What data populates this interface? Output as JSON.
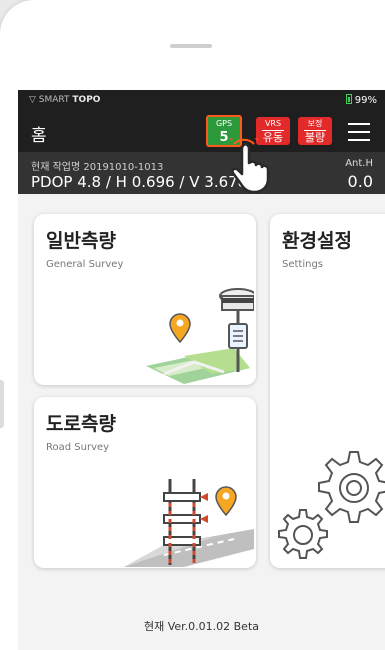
{
  "status_bar": {
    "brand_prefix": "SMART",
    "brand_name": "TOPO",
    "battery": "99%"
  },
  "app_bar": {
    "title": "홈",
    "gps": {
      "label": "GPS",
      "value": "5"
    },
    "vrs": {
      "label": "VRS",
      "value": "유동"
    },
    "correction": {
      "label": "보정",
      "value": "불량"
    }
  },
  "info_bar": {
    "job": "현재 작업명 20191010-1013",
    "pdop": "PDOP 4.8 / H 0.696 / V 3.678",
    "ant_label": "Ant.H",
    "ant_value": "0.0"
  },
  "cards": {
    "general": {
      "title": "일반측량",
      "subtitle": "General Survey"
    },
    "road": {
      "title": "도로측량",
      "subtitle": "Road Survey"
    },
    "settings": {
      "title": "환경설정",
      "subtitle": "Settings"
    }
  },
  "footer": {
    "version": "현재 Ver.0.01.02 Beta"
  },
  "colors": {
    "accent_orange": "#f5a623",
    "gps_green": "#2c9a3a",
    "alert_red": "#e22a2a",
    "highlight_border": "#ff5a1c"
  }
}
